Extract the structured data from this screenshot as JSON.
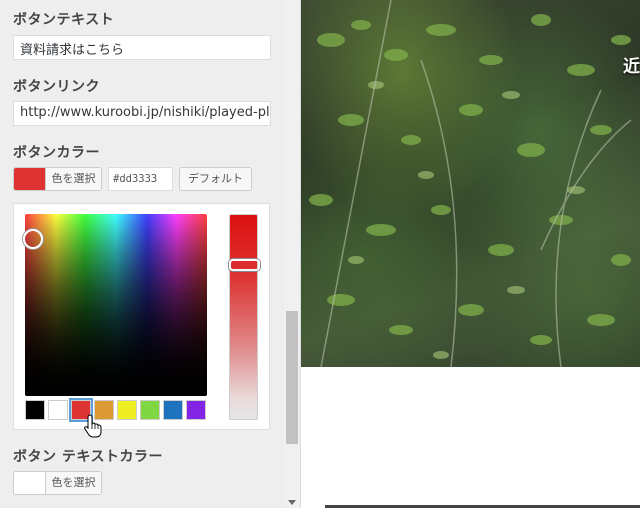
{
  "sidebar": {
    "button_text": {
      "label": "ボタンテキスト",
      "value": "資料請求はこちら"
    },
    "button_link": {
      "label": "ボタンリンク",
      "value": "http://www.kuroobi.jp/nishiki/played-ple"
    },
    "button_color": {
      "label": "ボタンカラー",
      "select_color_label": "色を選択",
      "hex_value": "#dd3333",
      "default_label": "デフォルト",
      "current_color": "#dd3333"
    },
    "picker": {
      "palette": [
        "#000000",
        "#ffffff",
        "#dd3333",
        "#dd9933",
        "#eeee22",
        "#81d742",
        "#1e73be",
        "#8224e3"
      ],
      "selected_index": 2
    },
    "button_text_color": {
      "label": "ボタン テキストカラー",
      "select_color_label": "色を選択",
      "current_color": "#ffffff"
    }
  },
  "preview": {
    "hero_text": "近"
  },
  "colors": {
    "accent": "#dd3333",
    "scroll_thumb": "#c1c1c1"
  }
}
